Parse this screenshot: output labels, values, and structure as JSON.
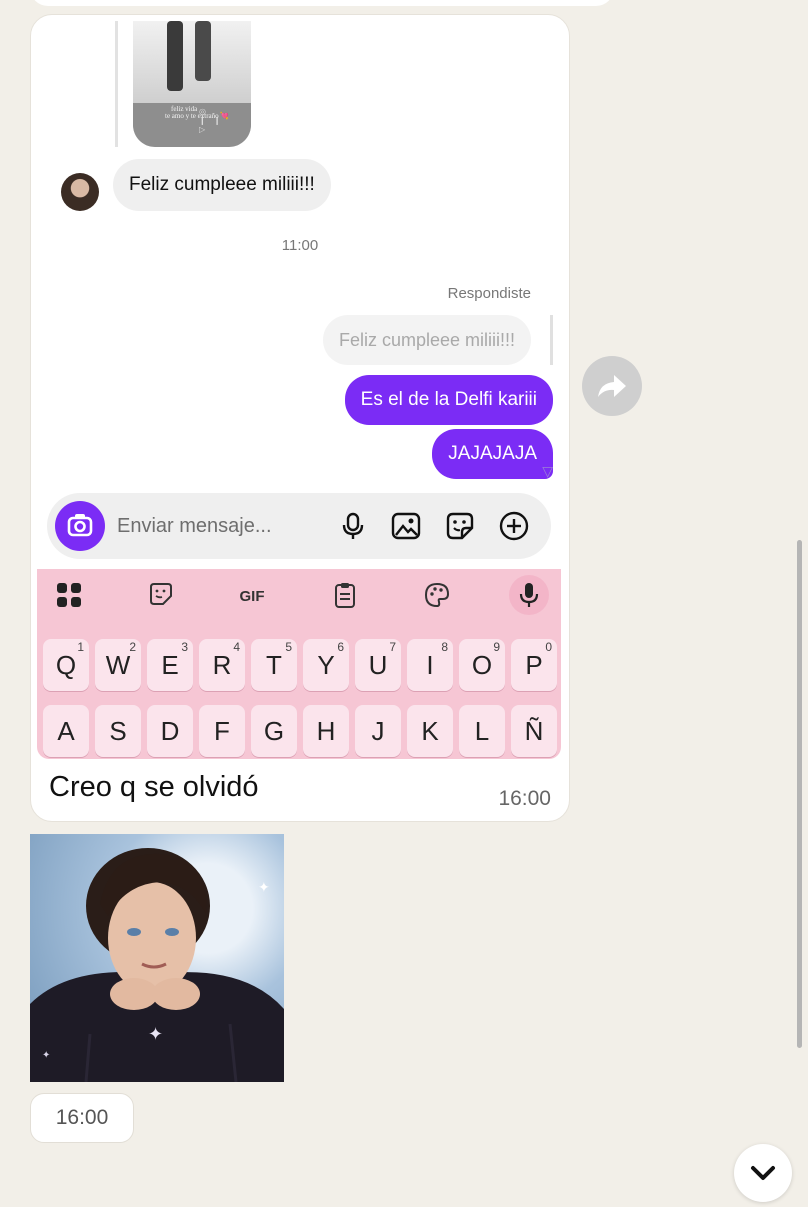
{
  "forwarded_screenshot": {
    "story_caption_line1": "feliz vida",
    "story_caption_line2": "te amo y te extraño 💘",
    "incoming_message": "Feliz cumpleee miliii!!!",
    "time_label": "11:00",
    "replied_label": "Respondiste",
    "reply_quote": "Feliz cumpleee miliii!!!",
    "outgoing_messages": [
      "Es el de la Delfi kariii",
      "JAJAJAJA"
    ],
    "composer_placeholder": "Enviar mensaje...",
    "composer_icons": [
      "camera-icon",
      "mic-icon",
      "image-icon",
      "sticker-icon",
      "add-icon"
    ],
    "keyboard": {
      "toolbar": [
        "apps-grid-icon",
        "sticker-icon",
        "GIF",
        "clipboard-icon",
        "palette-icon",
        "mic-icon"
      ],
      "row1": [
        "Q",
        "W",
        "E",
        "R",
        "T",
        "Y",
        "U",
        "I",
        "O",
        "P"
      ],
      "row1_numbers": [
        "1",
        "2",
        "3",
        "4",
        "5",
        "6",
        "7",
        "8",
        "9",
        "0"
      ],
      "row2": [
        "A",
        "S",
        "D",
        "F",
        "G",
        "H",
        "J",
        "K",
        "L",
        "Ñ"
      ]
    }
  },
  "message_caption": "Creo q se olvidó",
  "message_time": "16:00",
  "photo_time": "16:00",
  "colors": {
    "accent": "#7b2cf5",
    "keyboard": "#f6c6d4",
    "background": "#f2efe8"
  }
}
